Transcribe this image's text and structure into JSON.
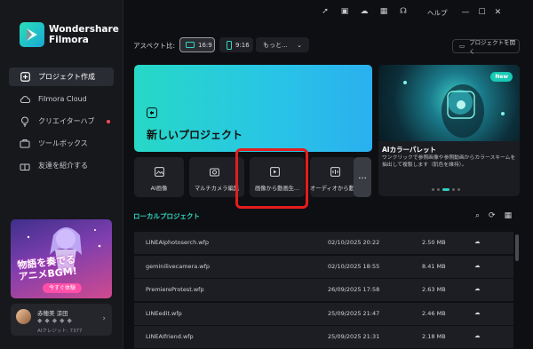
{
  "app": {
    "brand_line1": "Wondershare",
    "brand_line2": "Filmora"
  },
  "sidebar": {
    "items": [
      {
        "label": "プロジェクト作成",
        "icon": "plus-square-icon",
        "active": true
      },
      {
        "label": "Filmora Cloud",
        "icon": "cloud-icon",
        "active": false
      },
      {
        "label": "クリエイターハブ",
        "icon": "lightbulb-icon",
        "active": false
      },
      {
        "label": "ツールボックス",
        "icon": "toolbox-icon",
        "active": false
      },
      {
        "label": "友達を紹介する",
        "icon": "gift-icon",
        "active": false
      }
    ]
  },
  "promo": {
    "title_line1": "物語を奏でる",
    "title_line2": "アニメBGM!",
    "button": "今すぐ体験"
  },
  "user": {
    "name": "赤穂美 涼田",
    "credit": "AIクレジット: 7377"
  },
  "topbar": {
    "help": "ヘルプ"
  },
  "aspect": {
    "label": "アスペクト比:",
    "options": [
      "16:9",
      "9:16",
      "もっと..."
    ]
  },
  "open_project": "プロジェクトを開く",
  "new_project": {
    "label": "新しいプロジェクト"
  },
  "tools": [
    {
      "label": "AI画像",
      "icon": "ai-image-icon"
    },
    {
      "label": "マルチカメラ編集",
      "icon": "multicam-icon"
    },
    {
      "label": "画像から動画生...",
      "icon": "image-to-video-icon"
    },
    {
      "label": "オーディオから動...",
      "icon": "audio-to-video-icon"
    }
  ],
  "more_tools": "...",
  "ai_card": {
    "badge": "New",
    "title": "AIカラーパレット",
    "desc": "ワンクリックで参照画像や参照動画からカラースキームを抽出して複製します（肌色を維持）。"
  },
  "local": {
    "title": "ローカルプロジェクト"
  },
  "files": [
    {
      "name": "LINEAIphotoserch.wfp",
      "date": "02/10/2025 20:22",
      "size": "2.50 MB"
    },
    {
      "name": "geminilivecamera.wfp",
      "date": "02/10/2025 18:55",
      "size": "8.41 MB"
    },
    {
      "name": "PremiereProtest.wfp",
      "date": "26/09/2025 17:58",
      "size": "2.63 MB"
    },
    {
      "name": "LINEedit.wfp",
      "date": "25/09/2025 21:47",
      "size": "2.46 MB"
    },
    {
      "name": "LINEAIfriend.wfp",
      "date": "25/09/2025 21:31",
      "size": "2.18 MB"
    }
  ],
  "colors": {
    "accent": "#29d6c4",
    "highlight": "#e41d1d"
  }
}
